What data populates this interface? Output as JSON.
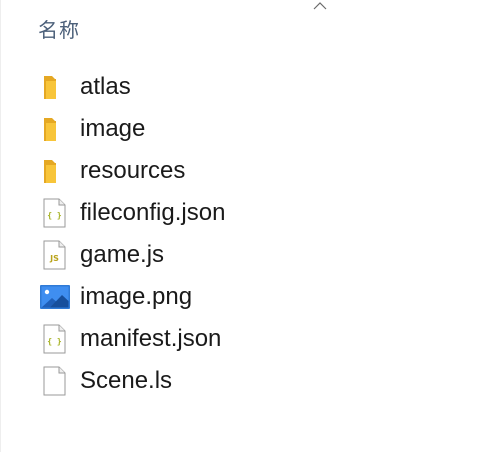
{
  "header": {
    "column_name": "名称",
    "sort_direction": "ascending"
  },
  "colors": {
    "folder": "#f8c53a",
    "json_icon_accent": "#a4b01e",
    "js_icon_accent": "#b9a31a",
    "image_icon": "#2f7ad6",
    "header_text": "#4c607a"
  },
  "files": [
    {
      "name": "atlas",
      "icon": "folder-icon"
    },
    {
      "name": "image",
      "icon": "folder-icon"
    },
    {
      "name": "resources",
      "icon": "folder-icon"
    },
    {
      "name": "fileconfig.json",
      "icon": "json-file-icon",
      "badge": "{ }"
    },
    {
      "name": "game.js",
      "icon": "js-file-icon",
      "badge": "JS"
    },
    {
      "name": "image.png",
      "icon": "image-file-icon"
    },
    {
      "name": "manifest.json",
      "icon": "json-file-icon",
      "badge": "{ }"
    },
    {
      "name": "Scene.ls",
      "icon": "blank-file-icon"
    }
  ]
}
